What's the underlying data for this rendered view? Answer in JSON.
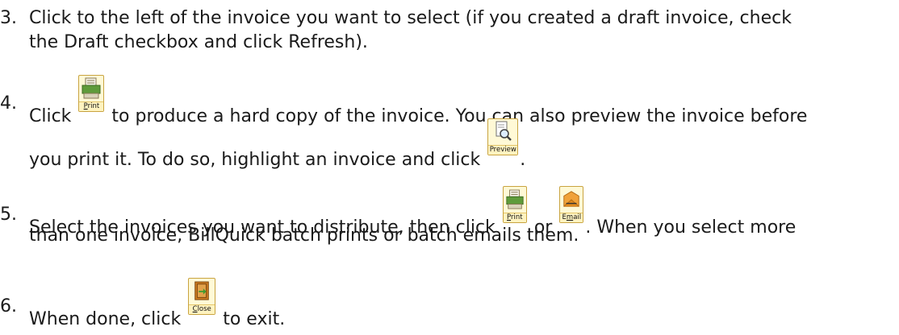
{
  "steps": [
    {
      "number": "3.",
      "line1": "Click to the left of the invoice you want to select (if you created a draft invoice, check",
      "line2": "the Draft checkbox and click Refresh)."
    },
    {
      "number": "4.",
      "before_print": "Click",
      "after_print": "to produce a hard copy of the invoice. You can also preview the invoice before",
      "line2_before_preview": "you print it. To do so, highlight an invoice and click",
      "line2_after_preview": "."
    },
    {
      "number": "5.",
      "before_print": "Select the invoices you want to distribute, then click",
      "between": "or",
      "after_email": ". When you select more",
      "line2": "than one invoice, BillQuick batch prints or batch emails them."
    },
    {
      "number": "6.",
      "before_close": "When done, click",
      "after_close": "to exit."
    }
  ],
  "buttons": {
    "print": {
      "prefix": "",
      "key": "P",
      "rest": "rint",
      "icon": "printer-icon"
    },
    "preview": {
      "label": "Preview",
      "icon": "magnifier-document-icon"
    },
    "email": {
      "prefix": "E",
      "key": "m",
      "rest": "ail",
      "icon": "envelope-icon"
    },
    "close": {
      "prefix": "",
      "key": "C",
      "rest": "lose",
      "icon": "exit-door-icon"
    }
  }
}
